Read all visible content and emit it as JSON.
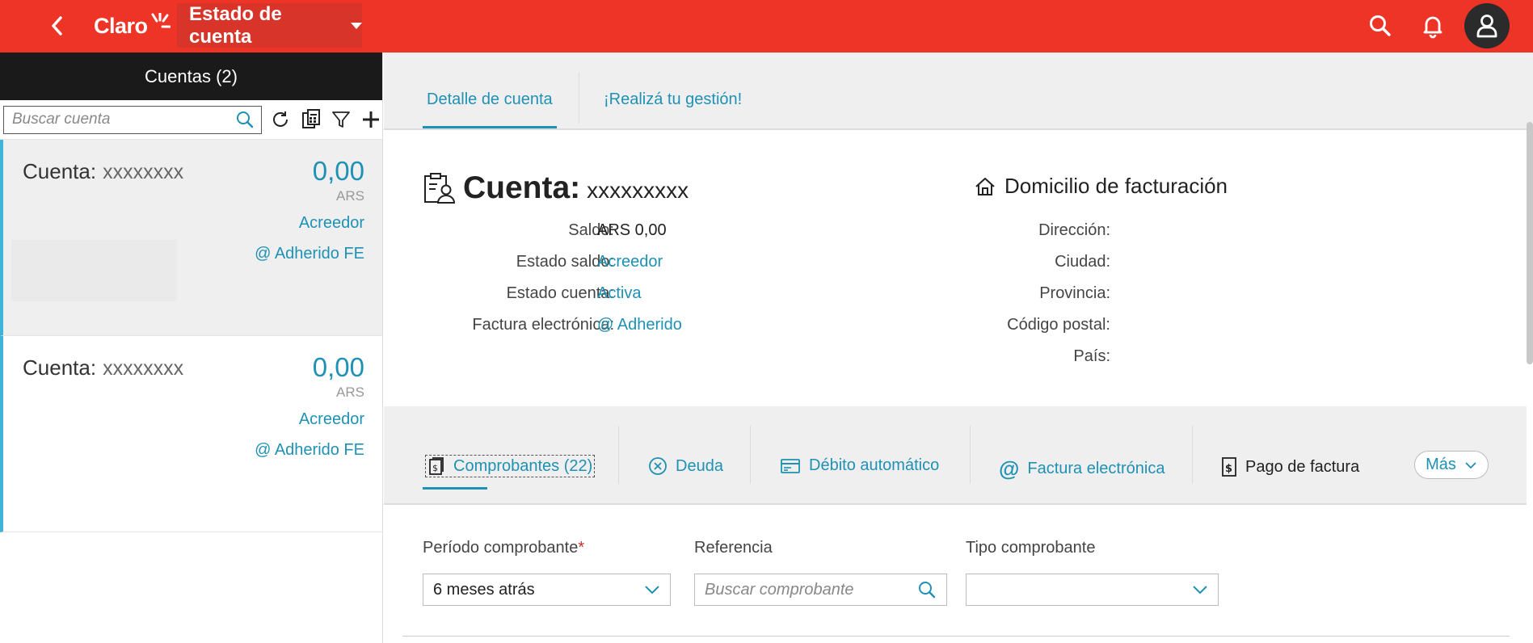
{
  "header": {
    "brand": "Claro",
    "page_title": "Estado de cuenta",
    "icons": [
      "back-icon",
      "search-icon",
      "bell-icon",
      "user-icon"
    ],
    "brand_color": "#ee3426"
  },
  "sidebar": {
    "title": "Cuentas (2)",
    "search_placeholder": "Buscar cuenta",
    "tools": [
      "refresh-icon",
      "calculator-icon",
      "filter-icon",
      "add-icon"
    ],
    "accounts": [
      {
        "label": "Cuenta:",
        "number": "xxxxxxxx",
        "amount": "0,00",
        "currency": "ARS",
        "status": "Acreedor",
        "fe": "@ Adherido FE"
      },
      {
        "label": "Cuenta:",
        "number": "xxxxxxxx",
        "amount": "0,00",
        "currency": "ARS",
        "status": "Acreedor",
        "fe": "@ Adherido FE"
      }
    ]
  },
  "main": {
    "tabs": [
      {
        "label": "Detalle de cuenta",
        "active": true
      },
      {
        "label": "¡Realizá tu gestión!",
        "active": false
      }
    ],
    "account": {
      "title": "Cuenta:",
      "number": "xxxxxxxxx",
      "fields": [
        {
          "label": "Saldo:",
          "value": "ARS 0,00"
        },
        {
          "label": "Estado saldo:",
          "value": "Acreedor"
        },
        {
          "label": "Estado cuenta:",
          "value": "Activa"
        },
        {
          "label": "Factura electrónica:",
          "value": "@ Adherido"
        }
      ]
    },
    "billing": {
      "title": "Domicilio de facturación",
      "fields": [
        {
          "label": "Dirección:"
        },
        {
          "label": "Ciudad:"
        },
        {
          "label": "Provincia:"
        },
        {
          "label": "Código postal:"
        },
        {
          "label": "País:"
        }
      ]
    },
    "sub_tabs": [
      {
        "label": "Comprobantes (22)",
        "icon": "receipt-icon"
      },
      {
        "label": "Deuda",
        "icon": "close-circle-icon"
      },
      {
        "label": "Débito automático",
        "icon": "card-icon"
      },
      {
        "label": "Factura electrónica",
        "icon": "at-icon"
      },
      {
        "label": "Pago de factura",
        "icon": "dollar-doc-icon"
      }
    ],
    "more_label": "Más",
    "filters": {
      "period_label": "Período comprobante",
      "period_required": "*",
      "period_value": "6 meses atrás",
      "reference_label": "Referencia",
      "reference_placeholder": "Buscar comprobante",
      "type_label": "Tipo comprobante",
      "type_value": ""
    },
    "accent_color": "#1e91b4"
  }
}
